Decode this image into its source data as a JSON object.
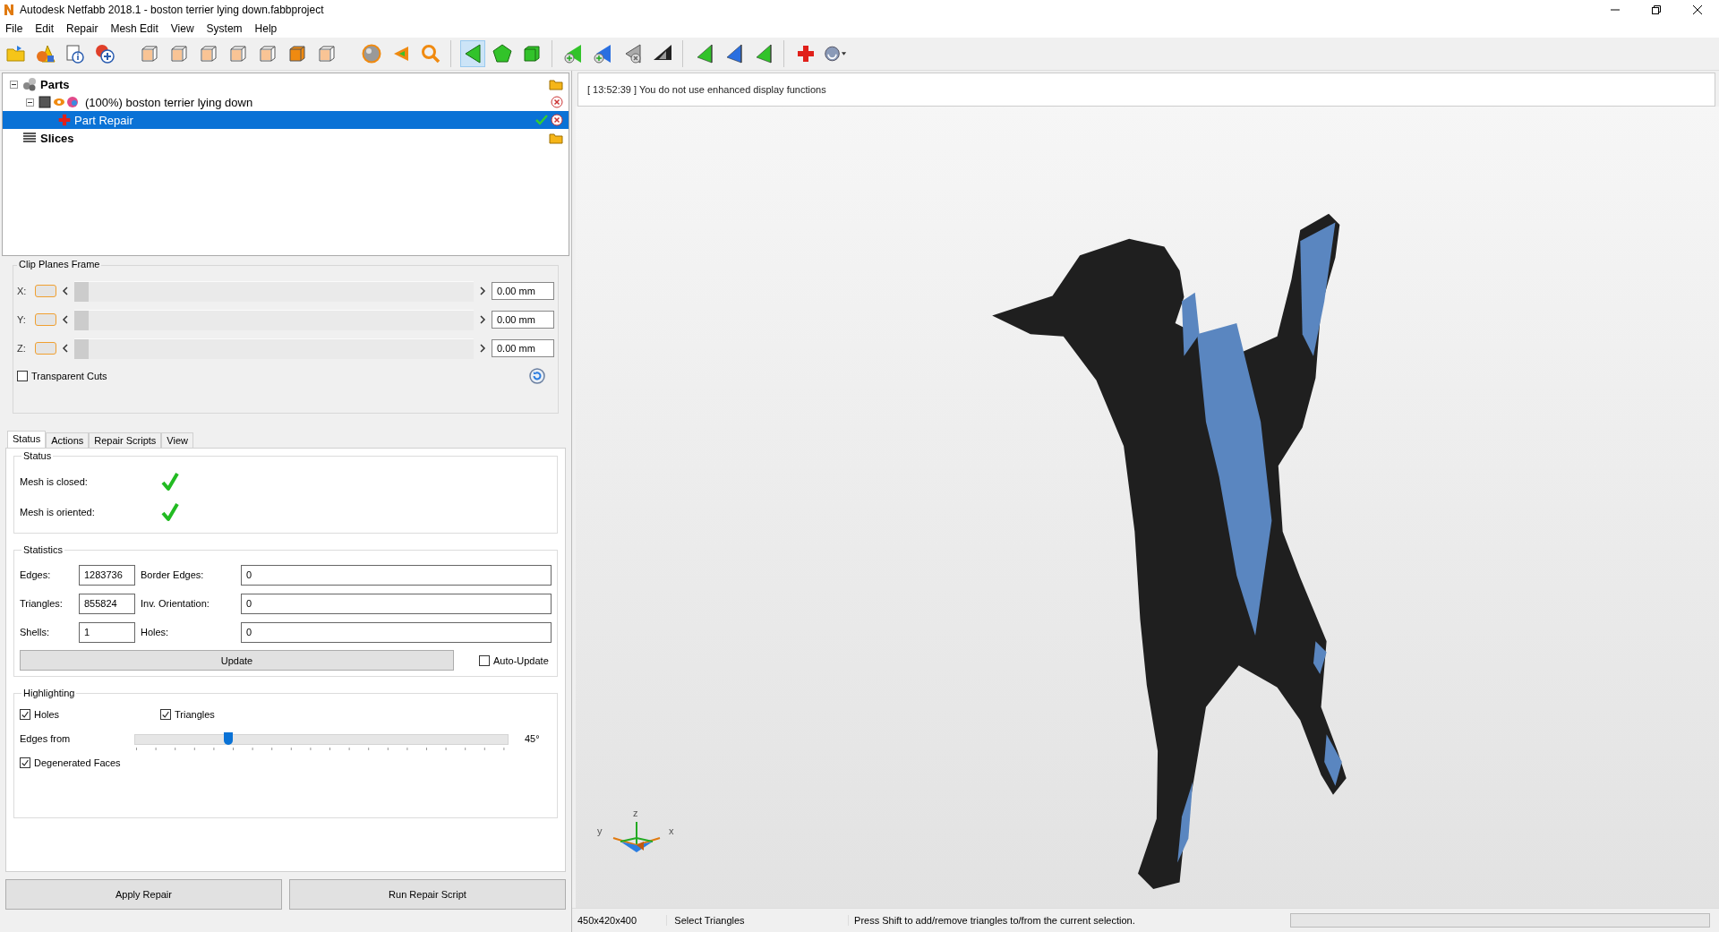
{
  "window": {
    "title": "Autodesk Netfabb 2018.1 - boston terrier lying down.fabbproject"
  },
  "menu": [
    "File",
    "Edit",
    "Repair",
    "Mesh Edit",
    "View",
    "System",
    "Help"
  ],
  "toolbar": [
    [
      {
        "kind": "open",
        "selected": false
      },
      {
        "kind": "shapes",
        "selected": false
      },
      {
        "kind": "info",
        "selected": false
      },
      {
        "kind": "add",
        "selected": false
      }
    ],
    [
      {
        "kind": "cube",
        "selected": false
      },
      {
        "kind": "cube",
        "selected": false
      },
      {
        "kind": "cube",
        "selected": false
      },
      {
        "kind": "cube",
        "selected": false
      },
      {
        "kind": "cube",
        "selected": false
      },
      {
        "kind": "solidcube",
        "selected": false
      },
      {
        "kind": "cube",
        "selected": false
      }
    ],
    [
      {
        "kind": "sphere",
        "selected": false
      },
      {
        "kind": "orangetri",
        "selected": false
      },
      {
        "kind": "zoom",
        "selected": false
      }
    ],
    [
      {
        "kind": "triangle",
        "selected": true
      },
      {
        "kind": "pentagon",
        "selected": false
      },
      {
        "kind": "greencube",
        "selected": false
      }
    ],
    [
      {
        "kind": "triplus",
        "selected": false
      },
      {
        "kind": "blueplus",
        "selected": false
      },
      {
        "kind": "grayx",
        "selected": false
      },
      {
        "kind": "blacktri",
        "selected": false
      }
    ],
    [
      {
        "kind": "greenleft",
        "selected": false
      },
      {
        "kind": "blueleft",
        "selected": false
      },
      {
        "kind": "greenleft",
        "selected": false
      }
    ],
    [
      {
        "kind": "repair",
        "selected": false
      },
      {
        "kind": "dropdown",
        "selected": false
      }
    ]
  ],
  "tree": [
    {
      "label": "Parts",
      "kind": "group",
      "expanded": true,
      "selected": false,
      "children": [
        {
          "label": "(100%) boston terrier lying down",
          "kind": "part",
          "expanded": true,
          "selected": false,
          "children": [
            {
              "label": "Part Repair",
              "kind": "repair",
              "selected": true
            }
          ]
        }
      ]
    },
    {
      "label": "Slices",
      "kind": "slices",
      "selected": false
    }
  ],
  "clip_planes": {
    "title": "Clip Planes Frame",
    "axes": [
      {
        "label": "X:",
        "value": "0.00 mm",
        "level": 0,
        "on": false
      },
      {
        "label": "Y:",
        "value": "0.00 mm",
        "level": 0,
        "on": false
      },
      {
        "label": "Z:",
        "value": "0.00 mm",
        "level": 0,
        "on": false
      }
    ],
    "transparent_cuts": {
      "label": "Transparent Cuts",
      "checked": false
    }
  },
  "tabs": [
    {
      "label": "Status",
      "selected": true
    },
    {
      "label": "Actions",
      "selected": false
    },
    {
      "label": "Repair Scripts",
      "selected": false
    },
    {
      "label": "View",
      "selected": false
    }
  ],
  "status": {
    "title": "Status",
    "items": [
      {
        "label": "Mesh is closed:",
        "ok": true
      },
      {
        "label": "Mesh is oriented:",
        "ok": true
      }
    ]
  },
  "statistics": {
    "title": "Statistics",
    "rows": [
      {
        "label": "Edges:",
        "value": "1283736",
        "label_2": "Border Edges:",
        "value_2": "0"
      },
      {
        "label": "Triangles:",
        "value": "855824",
        "label_2": "Inv. Orientation:",
        "value_2": "0"
      },
      {
        "label": "Shells:",
        "value": "1",
        "label_2": "Holes:",
        "value_2": "0"
      }
    ],
    "update_button": "Update",
    "auto_update": {
      "label": "Auto-Update",
      "checked": false
    }
  },
  "highlighting": {
    "title": "Highlighting",
    "holes": {
      "label": "Holes",
      "checked": true
    },
    "triangles": {
      "label": "Triangles",
      "checked": true
    },
    "edges_from": {
      "label": "Edges from",
      "level": 0.25,
      "reading": "45°"
    },
    "degenerated_faces": {
      "label": "Degenerated Faces",
      "checked": true
    }
  },
  "buttons": [
    "Apply Repair",
    "Run Repair Script"
  ],
  "log": "[ 13:52:39 ] You do not use enhanced display functions",
  "axes": {
    "z": "z",
    "y": "y",
    "x": "x"
  },
  "status_bar": {
    "texts": [
      "450x420x400",
      "Select Triangles",
      "Press Shift to add/remove triangles to/from the current selection."
    ],
    "progress": {
      "level": 0
    }
  }
}
